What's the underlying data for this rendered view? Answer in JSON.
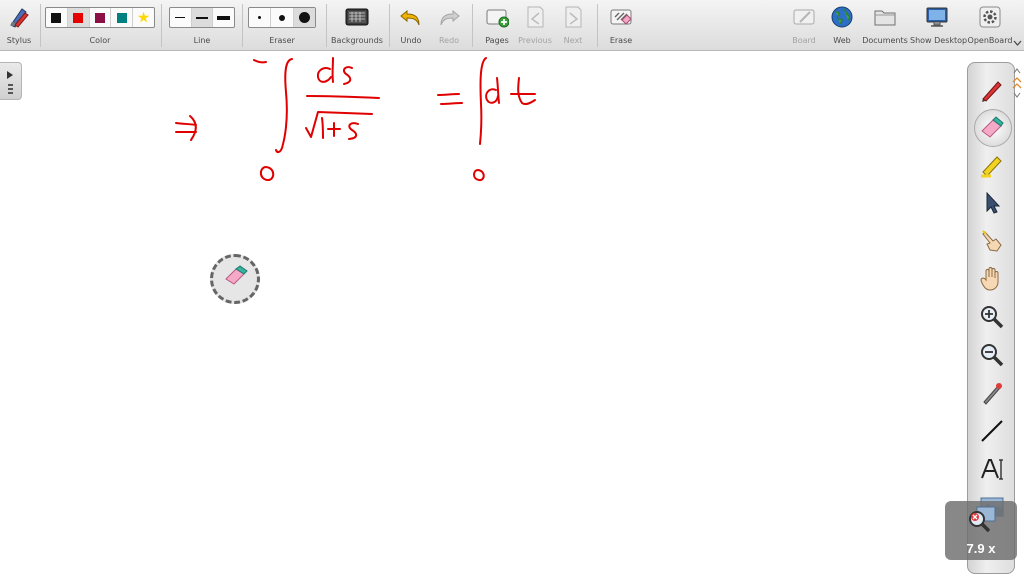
{
  "toolbar": {
    "stylus_label": "Stylus",
    "color_label": "Color",
    "line_label": "Line",
    "eraser_label": "Eraser",
    "backgrounds_label": "Backgrounds",
    "undo_label": "Undo",
    "redo_label": "Redo",
    "pages_label": "Pages",
    "previous_label": "Previous",
    "next_label": "Next",
    "erase_label": "Erase",
    "board_label": "Board",
    "web_label": "Web",
    "documents_label": "Documents",
    "show_desktop_label": "Show Desktop",
    "openboard_label": "OpenBoard",
    "colors": [
      "#111111",
      "#e60000",
      "#8a1045",
      "#008080",
      "#ffd800"
    ],
    "selected_color_index": 1,
    "selected_line_index": 1,
    "selected_eraser_index": 2
  },
  "dock": {
    "tools": [
      "pen-tool",
      "eraser-tool",
      "marker-tool",
      "selector-tool",
      "interact-tool",
      "hand-tool",
      "zoom-in-tool",
      "zoom-out-tool",
      "laser-pointer-tool",
      "line-tool",
      "text-tool",
      "capture-tool"
    ],
    "selected_tool": "eraser-tool"
  },
  "zoom": {
    "level_text": "7.9 x"
  },
  "canvas": {
    "ink_color": "#e00000"
  }
}
